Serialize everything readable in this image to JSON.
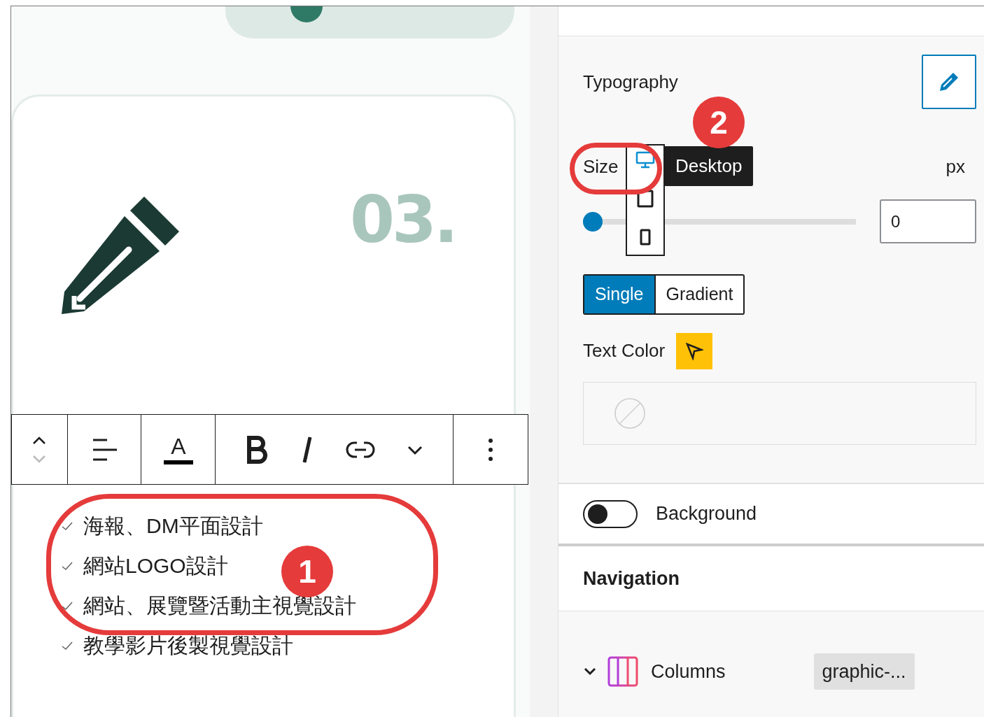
{
  "editor": {
    "card_number": "03.",
    "toolbar": [
      {
        "kind": "mover"
      },
      {
        "kind": "align"
      },
      {
        "kind": "text-color",
        "glyph": "A"
      },
      {
        "kind": "bold"
      },
      {
        "kind": "italic"
      },
      {
        "kind": "link"
      },
      {
        "kind": "more-formats"
      },
      {
        "kind": "options"
      }
    ],
    "list_items": [
      "海報、DM平面設計",
      "網站LOGO設計",
      "網站、展覽暨活動主視覺設計",
      "教學影片後製視覺設計"
    ]
  },
  "sidebar": {
    "typography": {
      "label": "Typography",
      "size_label": "Size",
      "devices": [
        {
          "kind": "desktop",
          "selected": true
        },
        {
          "kind": "tablet",
          "selected": false
        },
        {
          "kind": "mobile",
          "selected": false
        }
      ],
      "tooltip": "Desktop",
      "unit": "px",
      "slider": {
        "level": 0
      },
      "value": "0",
      "color_modes": [
        {
          "label": "Single",
          "selected": true
        },
        {
          "label": "Gradient",
          "selected": false
        }
      ],
      "text_color_label": "Text Color"
    },
    "background": {
      "label": "Background",
      "on": false
    },
    "navigation": {
      "title": "Navigation",
      "items": [
        {
          "label": "Columns",
          "tag": "graphic-...",
          "expanded": true
        }
      ]
    }
  },
  "annotations": [
    {
      "number": "1"
    },
    {
      "number": "2"
    }
  ]
}
